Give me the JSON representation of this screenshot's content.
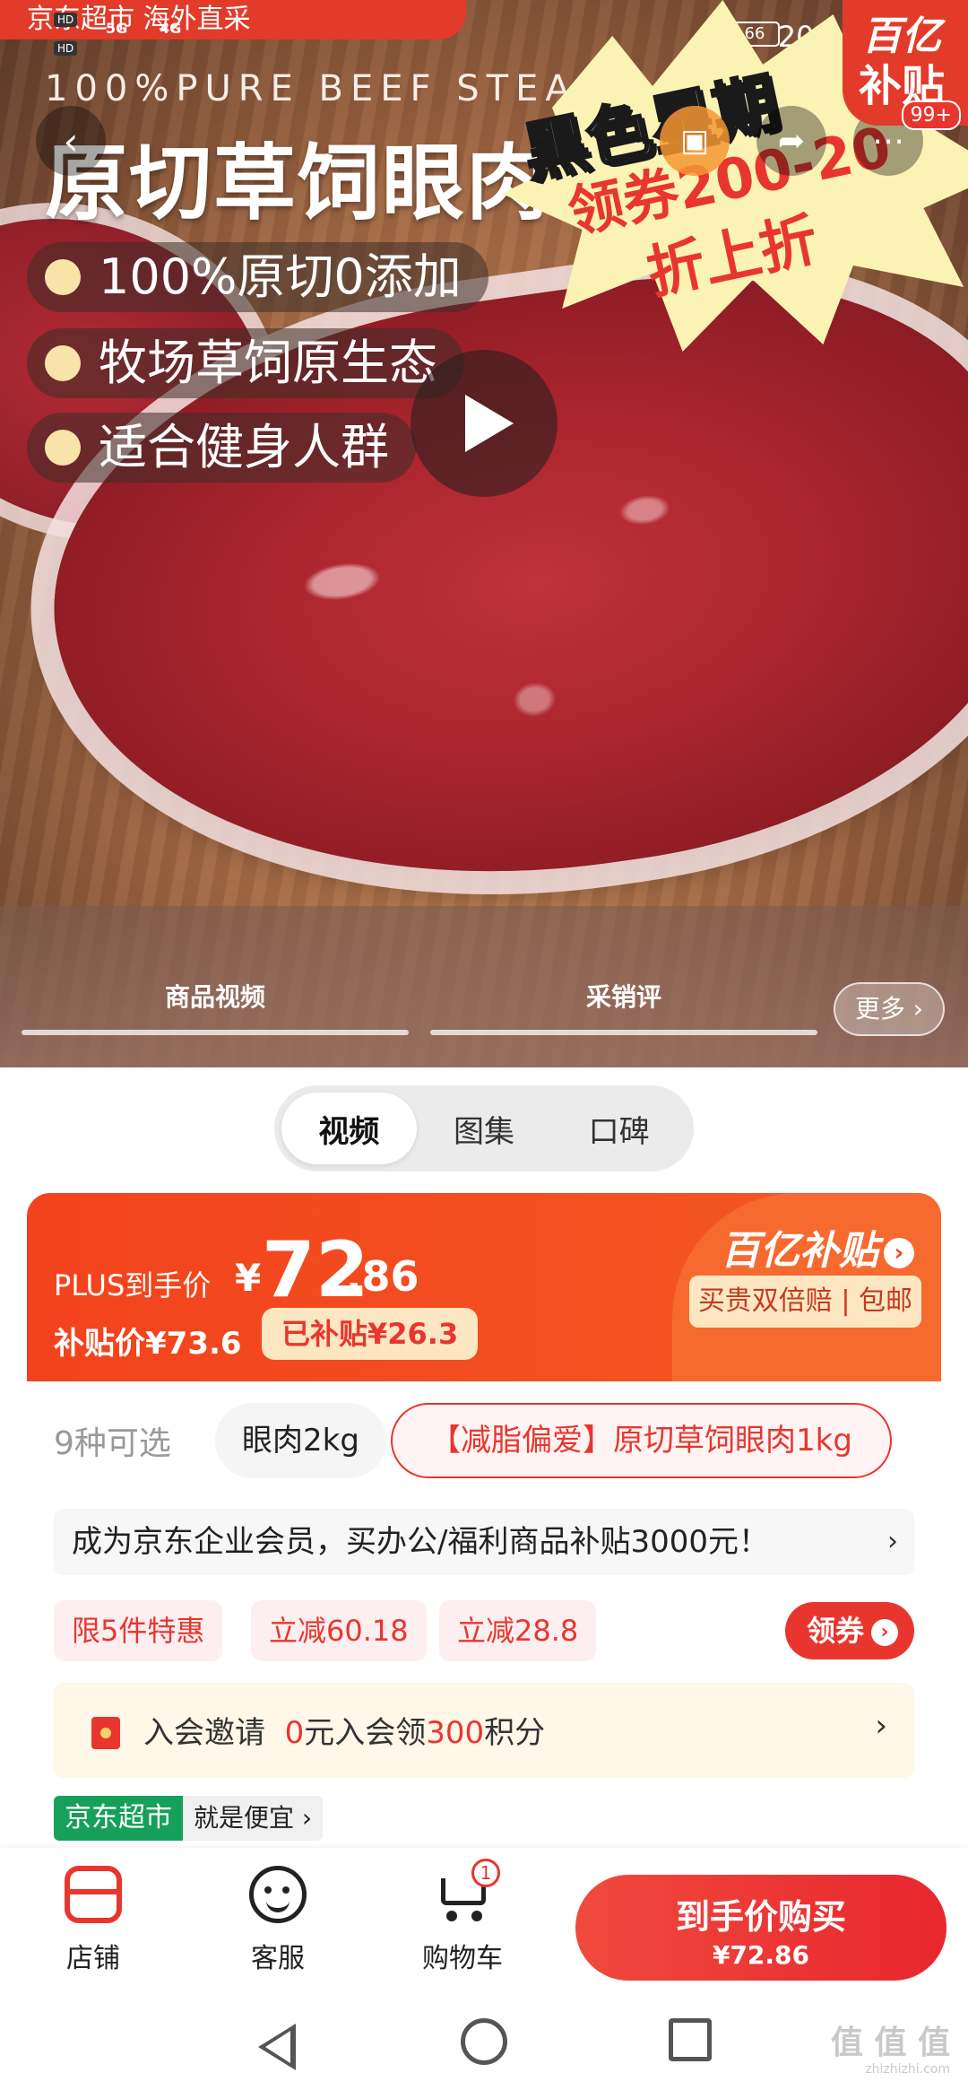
{
  "status_bar": {
    "network_labels": [
      "HD",
      "HD"
    ],
    "signal_labels": [
      "5G",
      "4G"
    ],
    "battery": "66",
    "time": "20:05"
  },
  "hero": {
    "promo_strip": "京东超市 海外直采",
    "sub_title": "100%PURE BEEF STEA",
    "title": "原切草饲眼肉",
    "bullets": [
      "100%原切0添加",
      "牧场草饲原生态",
      "适合健身人群"
    ],
    "burst_black": "黑色星期",
    "burst_red_line1": "领券200-20",
    "burst_red_line2": "折上折",
    "subsidy_corner_line1": "百亿",
    "subsidy_corner_line2": "补贴",
    "badge_count": "99+",
    "tabs": [
      "商品视频",
      "采销评"
    ],
    "more_label": "更多 ›"
  },
  "segment": {
    "items": [
      "视频",
      "图集",
      "口碑"
    ],
    "active_index": 0
  },
  "price": {
    "plus_label": "PLUS到手价",
    "currency": "¥",
    "integer": "72",
    "decimal": ".86",
    "subsidy_price": "补贴价¥73.6",
    "subsidized_amount": "已补贴¥26.3",
    "brand_label": "百亿补贴",
    "brand_arrow": "›",
    "guarantee": "买贵双倍赔 | 包邮"
  },
  "sku": {
    "count_label": "9种可选",
    "options": [
      "眼肉2kg",
      "【减脂偏爱】原切草饲眼肉1kg"
    ],
    "selected_index": 1
  },
  "notice": {
    "text": "成为京东企业会员，买办公/福利商品补贴3000元！",
    "arrow": "›"
  },
  "tags": {
    "items": [
      "限5件特惠",
      "立减60.18",
      "立减28.8"
    ],
    "coupon_label": "领券",
    "coupon_arrow": "›"
  },
  "member": {
    "prefix": "入会邀请",
    "highlight1": "0",
    "mid": "元入会领",
    "highlight2": "300",
    "suffix": "积分",
    "arrow": "›"
  },
  "jd": {
    "tag": "京东超市",
    "slogan": "就是便宜 ›"
  },
  "bottom_bar": {
    "store_label": "店铺",
    "service_label": "客服",
    "cart_label": "购物车",
    "cart_count": "1",
    "buy_line1": "到手价购买",
    "buy_line2": "¥72.86"
  },
  "watermark": {
    "main": "值 值 值",
    "sub": "zhizhizhi.com"
  },
  "colors": {
    "accent_red": "#e8362e",
    "price_orange": "#f3421e",
    "jd_green": "#16a05a"
  }
}
